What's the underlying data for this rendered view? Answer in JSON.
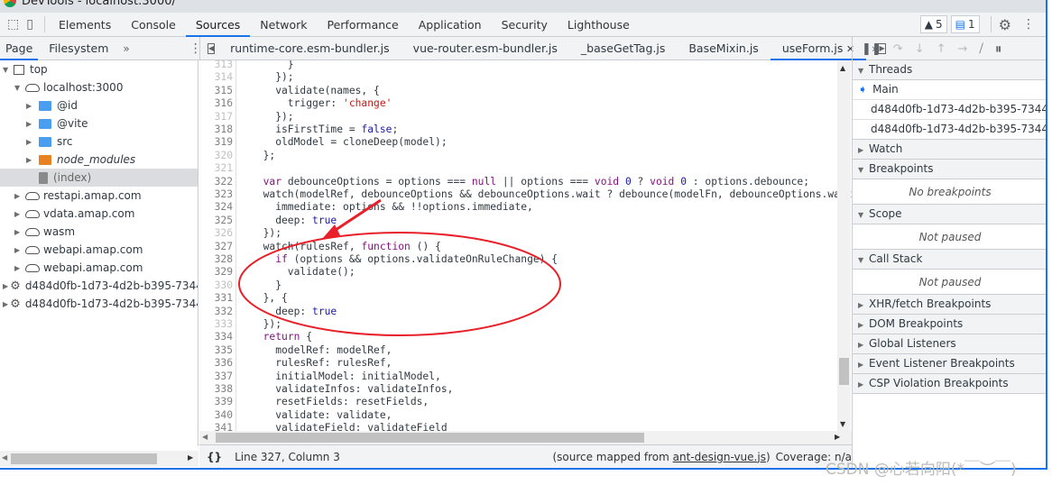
{
  "window_title": "DevTools - localhost:3000/",
  "main_tabs": [
    "Elements",
    "Console",
    "Sources",
    "Network",
    "Performance",
    "Application",
    "Security",
    "Lighthouse"
  ],
  "active_tab": "Sources",
  "warnings_count": "5",
  "messages_count": "1",
  "navigator_tabs": [
    "Page",
    "Filesystem"
  ],
  "file_tabs": [
    "runtime-core.esm-bundler.js",
    "vue-router.esm-bundler.js",
    "_baseGetTag.js",
    "BaseMixin.js",
    "useForm.js"
  ],
  "active_file": "useForm.js",
  "tree": [
    {
      "label": "top",
      "depth": 0,
      "type": "frame",
      "open": true
    },
    {
      "label": "localhost:3000",
      "depth": 1,
      "type": "cloud",
      "open": true
    },
    {
      "label": "@id",
      "depth": 2,
      "type": "folder",
      "color": "#4a9ef0"
    },
    {
      "label": "@vite",
      "depth": 2,
      "type": "folder",
      "color": "#4a9ef0"
    },
    {
      "label": "src",
      "depth": 2,
      "type": "folder",
      "color": "#4a9ef0"
    },
    {
      "label": "node_modules",
      "depth": 2,
      "type": "folder",
      "color": "#e8811f",
      "italic": true
    },
    {
      "label": "(index)",
      "depth": 2,
      "type": "file",
      "selected": true
    },
    {
      "label": "restapi.amap.com",
      "depth": 1,
      "type": "cloud"
    },
    {
      "label": "vdata.amap.com",
      "depth": 1,
      "type": "cloud"
    },
    {
      "label": "wasm",
      "depth": 1,
      "type": "cloud"
    },
    {
      "label": "webapi.amap.com",
      "depth": 1,
      "type": "cloud"
    },
    {
      "label": "webapi.amap.com",
      "depth": 1,
      "type": "cloud"
    },
    {
      "label": "d484d0fb-1d73-4d2b-b395-7344ba",
      "depth": 0,
      "type": "gear"
    },
    {
      "label": "d484d0fb-1d73-4d2b-b395-7344ba",
      "depth": 0,
      "type": "gear"
    }
  ],
  "code": [
    {
      "n": "313",
      "dim": true,
      "t": [
        [
          "      }",
          ""
        ]
      ]
    },
    {
      "n": "314",
      "dim": true,
      "t": [
        [
          "    });",
          ""
        ]
      ]
    },
    {
      "n": "315",
      "t": [
        [
          "    validate(names, {",
          ""
        ]
      ]
    },
    {
      "n": "316",
      "t": [
        [
          "      trigger: ",
          ""
        ],
        [
          "'change'",
          "s"
        ]
      ]
    },
    {
      "n": "317",
      "dim": true,
      "t": [
        [
          "    });",
          ""
        ]
      ]
    },
    {
      "n": "318",
      "t": [
        [
          "    isFirstTime = ",
          ""
        ],
        [
          "false",
          "v"
        ],
        [
          ";",
          ""
        ]
      ]
    },
    {
      "n": "319",
      "t": [
        [
          "    oldModel = cloneDeep(model);",
          ""
        ]
      ]
    },
    {
      "n": "320",
      "dim": true,
      "t": [
        [
          "  };",
          ""
        ]
      ]
    },
    {
      "n": "321",
      "dim": true,
      "t": [
        [
          "",
          ""
        ]
      ]
    },
    {
      "n": "322",
      "t": [
        [
          "  ",
          ""
        ],
        [
          "var",
          "k"
        ],
        [
          " debounceOptions = options === ",
          ""
        ],
        [
          "null",
          "k"
        ],
        [
          " || options === ",
          ""
        ],
        [
          "void",
          "k"
        ],
        [
          " ",
          ""
        ],
        [
          "0",
          "v"
        ],
        [
          " ? ",
          ""
        ],
        [
          "void",
          "k"
        ],
        [
          " ",
          ""
        ],
        [
          "0",
          "v"
        ],
        [
          " : options.debounce;",
          ""
        ]
      ]
    },
    {
      "n": "323",
      "t": [
        [
          "  watch(modelRef, debounceOptions && debounceOptions.wait ? debounce(modelFn, debounceOptions.wait, ",
          ""
        ]
      ]
    },
    {
      "n": "324",
      "t": [
        [
          "    immediate: options && !!options.immediate,",
          ""
        ]
      ]
    },
    {
      "n": "325",
      "t": [
        [
          "    deep: ",
          ""
        ],
        [
          "true",
          "v"
        ]
      ]
    },
    {
      "n": "326",
      "dim": true,
      "t": [
        [
          "  });",
          ""
        ]
      ]
    },
    {
      "n": "327",
      "t": [
        [
          "  watch(rulesRef, ",
          ""
        ],
        [
          "function",
          "k"
        ],
        [
          " () {",
          ""
        ]
      ]
    },
    {
      "n": "328",
      "t": [
        [
          "    ",
          ""
        ],
        [
          "if",
          "k"
        ],
        [
          " (options && options.validateOnRuleChange) {",
          ""
        ]
      ]
    },
    {
      "n": "329",
      "t": [
        [
          "      validate();",
          ""
        ]
      ]
    },
    {
      "n": "330",
      "dim": true,
      "t": [
        [
          "    }",
          ""
        ]
      ]
    },
    {
      "n": "331",
      "t": [
        [
          "  }, {",
          ""
        ]
      ]
    },
    {
      "n": "332",
      "t": [
        [
          "    deep: ",
          ""
        ],
        [
          "true",
          "v"
        ]
      ]
    },
    {
      "n": "333",
      "dim": true,
      "t": [
        [
          "  });",
          ""
        ]
      ]
    },
    {
      "n": "334",
      "t": [
        [
          "  ",
          ""
        ],
        [
          "return",
          "k"
        ],
        [
          " {",
          ""
        ]
      ]
    },
    {
      "n": "335",
      "t": [
        [
          "    modelRef: modelRef,",
          ""
        ]
      ]
    },
    {
      "n": "336",
      "t": [
        [
          "    rulesRef: rulesRef,",
          ""
        ]
      ]
    },
    {
      "n": "337",
      "t": [
        [
          "    initialModel: initialModel,",
          ""
        ]
      ]
    },
    {
      "n": "338",
      "t": [
        [
          "    validateInfos: validateInfos,",
          ""
        ]
      ]
    },
    {
      "n": "339",
      "t": [
        [
          "    resetFields: resetFields,",
          ""
        ]
      ]
    },
    {
      "n": "340",
      "t": [
        [
          "    validate: validate,",
          ""
        ]
      ]
    },
    {
      "n": "341",
      "t": [
        [
          "    validateField: validateField",
          ""
        ]
      ]
    }
  ],
  "status": {
    "position": "Line 327, Column 3",
    "source_prefix": "(source mapped from ",
    "source_link": "ant-design-vue.js",
    "source_suffix": ")",
    "coverage": "Coverage: n/a"
  },
  "sidebar": {
    "threads": {
      "title": "Threads",
      "items": [
        "Main",
        "d484d0fb-1d73-4d2b-b395-7344...",
        "d484d0fb-1d73-4d2b-b395-7344..."
      ]
    },
    "watch": "Watch",
    "breakpoints": {
      "title": "Breakpoints",
      "empty": "No breakpoints"
    },
    "scope": {
      "title": "Scope",
      "empty": "Not paused"
    },
    "call_stack": {
      "title": "Call Stack",
      "empty": "Not paused"
    },
    "collapsed": [
      "XHR/fetch Breakpoints",
      "DOM Breakpoints",
      "Global Listeners",
      "Event Listener Breakpoints",
      "CSP Violation Breakpoints"
    ]
  },
  "watermark": "CSDN @心若向阳(*￣︶￣)",
  "annotation_color": "#e8202a",
  "accent": "#1a73e8"
}
